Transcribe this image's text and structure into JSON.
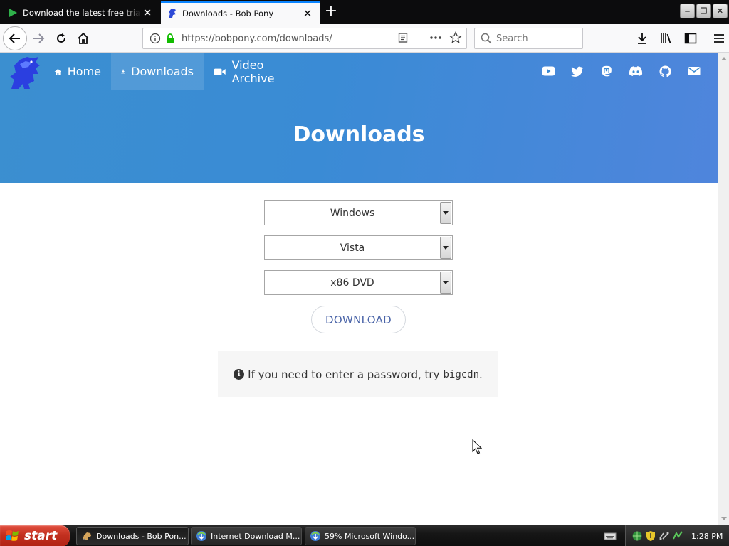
{
  "browser": {
    "tabs": [
      {
        "title": "Download the latest free trial versi",
        "active": false
      },
      {
        "title": "Downloads - Bob Pony",
        "active": true
      }
    ],
    "url": "https://bobpony.com/downloads/",
    "search_placeholder": "Search"
  },
  "site": {
    "nav": [
      {
        "label": "Home",
        "icon": "home-icon"
      },
      {
        "label": "Downloads",
        "icon": "download-icon"
      },
      {
        "label": "Video Archive",
        "icon": "video-camera-icon"
      }
    ],
    "social_icons": [
      "youtube-icon",
      "twitter-icon",
      "mastodon-icon",
      "discord-icon",
      "github-icon",
      "email-icon"
    ],
    "hero_title": "Downloads",
    "selects": {
      "os": "Windows",
      "version": "Vista",
      "edition": "x86 DVD"
    },
    "download_button": "DOWNLOAD",
    "notice_text": "If you need to enter a password, try",
    "notice_password": "bigcdn",
    "notice_end": ".",
    "colors": {
      "hero_start": "#3b8fd0",
      "hero_end": "#4f85dc",
      "button_text": "#4a64a8"
    }
  },
  "taskbar": {
    "start_label": "start",
    "tasks": [
      {
        "label": "Downloads - Bob Pon..."
      },
      {
        "label": "Internet Download M..."
      },
      {
        "label": "59% Microsoft Windo..."
      }
    ],
    "clock": "1:28 PM"
  }
}
